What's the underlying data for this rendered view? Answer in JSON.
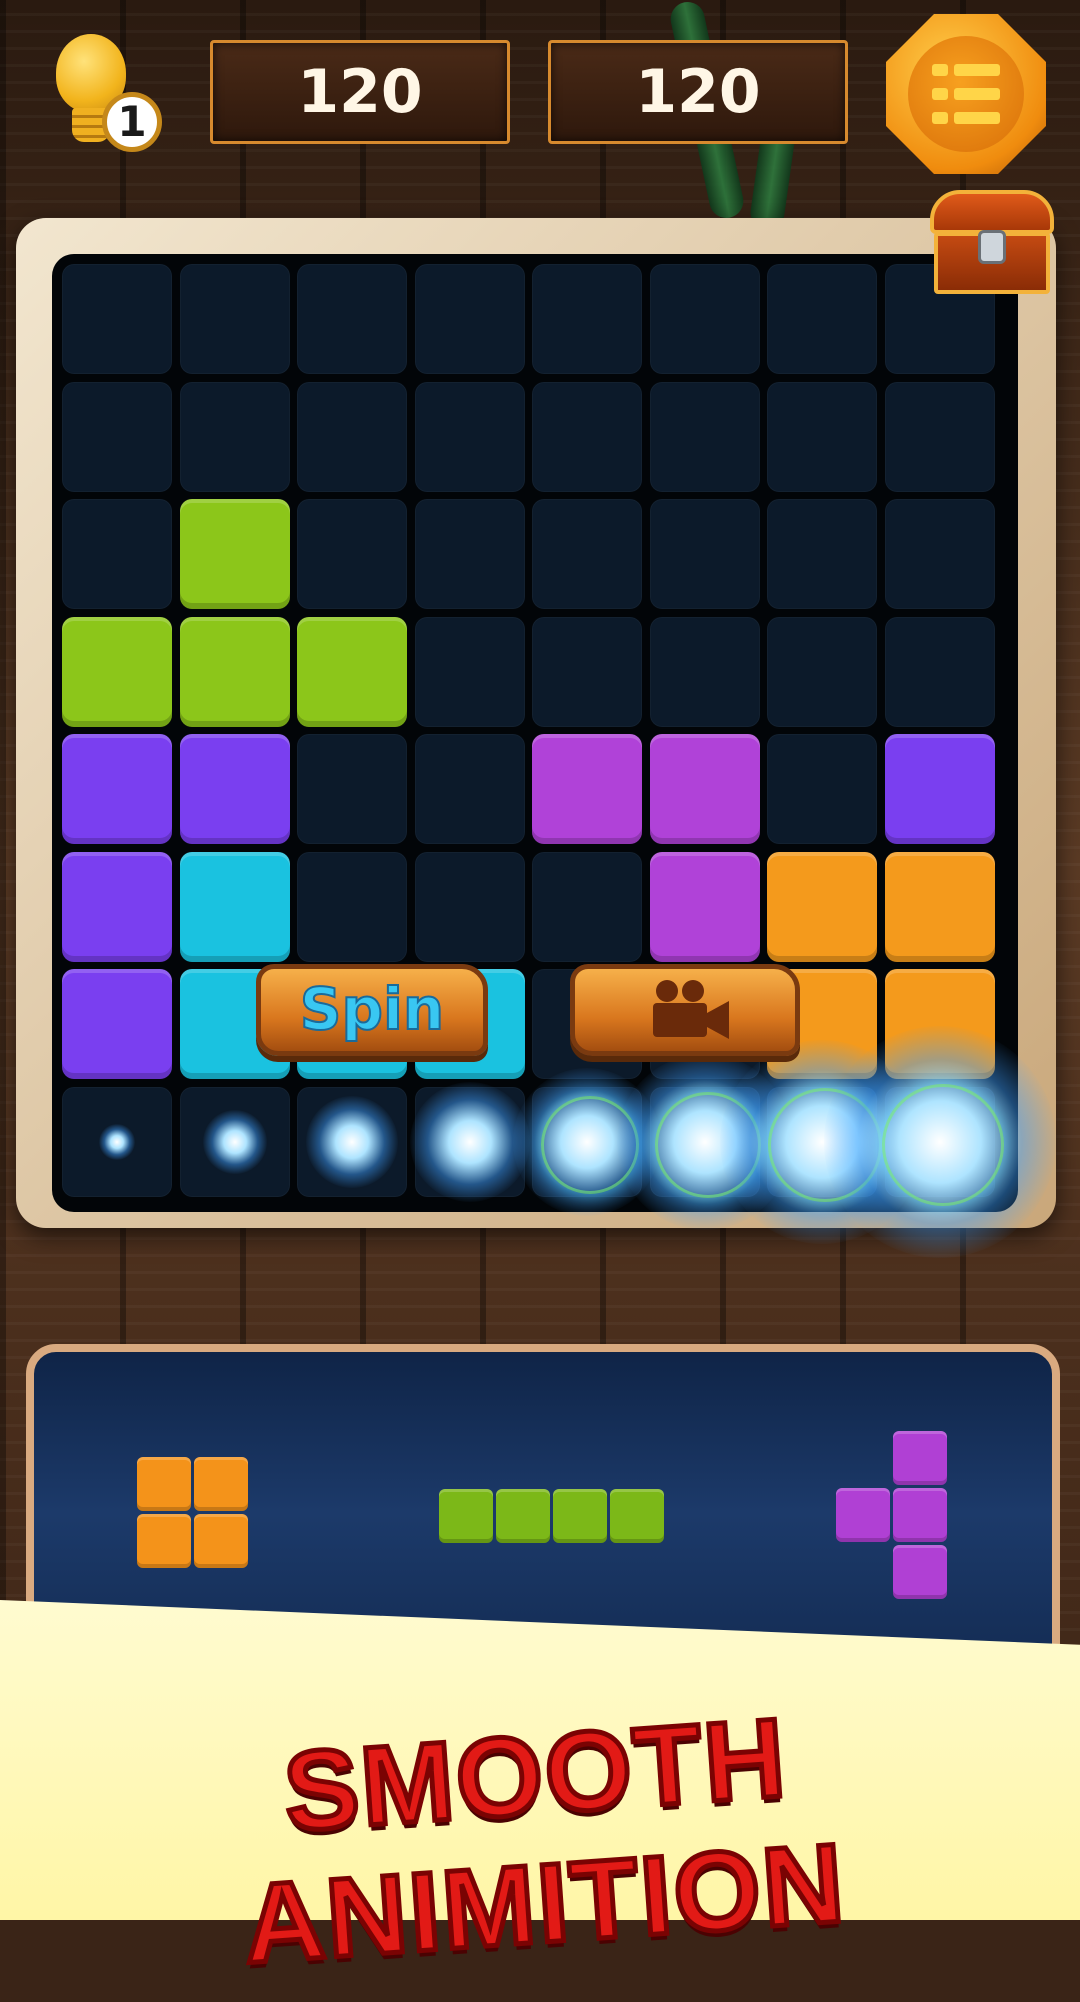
{
  "hud": {
    "hints": "1",
    "score_current": "120",
    "score_best": "120",
    "icons": {
      "hint": "lightbulb-icon",
      "menu": "menu-list-icon",
      "chest": "treasure-chest-icon"
    }
  },
  "board": {
    "columns": 8,
    "rows": 8,
    "cells": [
      [
        "",
        "",
        "",
        "",
        "",
        "",
        "",
        ""
      ],
      [
        "",
        "",
        "",
        "",
        "",
        "",
        "",
        ""
      ],
      [
        "",
        "G",
        "",
        "",
        "",
        "",
        "",
        ""
      ],
      [
        "G",
        "G",
        "G",
        "",
        "",
        "",
        "",
        ""
      ],
      [
        "P",
        "P",
        "",
        "",
        "M",
        "M",
        "",
        "P"
      ],
      [
        "P",
        "C",
        "",
        "",
        "",
        "M",
        "O",
        "O"
      ],
      [
        "P",
        "C",
        "C",
        "C",
        "",
        "",
        "O",
        "O"
      ],
      [
        "",
        "",
        "",
        "",
        "",
        "",
        "",
        ""
      ]
    ],
    "bottom_row": "clearing-animation",
    "colors": {
      "G": "#8cc61a",
      "P": "#7a3ff0",
      "M": "#b042d8",
      "C": "#1ac2e0",
      "O": "#f49a1c",
      "empty": "#0c1a2a"
    },
    "buttons": {
      "spin_label": "Spin",
      "video_icon": "video-camera-icon"
    }
  },
  "tray": {
    "pieces": [
      {
        "name": "square",
        "color": "#f4931a",
        "cells": [
          [
            0,
            0
          ],
          [
            1,
            0
          ],
          [
            0,
            1
          ],
          [
            1,
            1
          ]
        ]
      },
      {
        "name": "line",
        "color": "#7cb818",
        "cells": [
          [
            0,
            0
          ],
          [
            1,
            0
          ],
          [
            2,
            0
          ],
          [
            3,
            0
          ]
        ]
      },
      {
        "name": "t-shape",
        "color": "#b040d4",
        "cells": [
          [
            1,
            0
          ],
          [
            0,
            1
          ],
          [
            1,
            1
          ],
          [
            1,
            2
          ]
        ]
      }
    ]
  },
  "banner": {
    "text": "SMOOTH ANIMITION"
  }
}
